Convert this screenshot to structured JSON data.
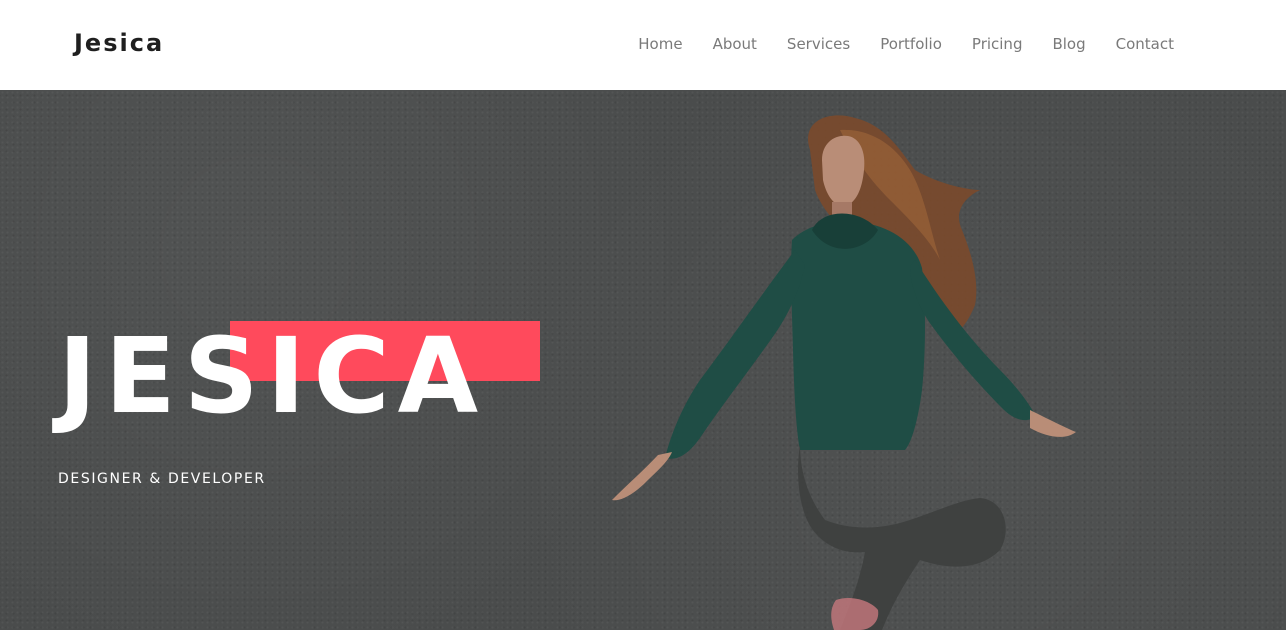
{
  "brand": {
    "logo_text": "Jesica"
  },
  "nav": {
    "items": [
      {
        "label": "Home"
      },
      {
        "label": "About"
      },
      {
        "label": "Services"
      },
      {
        "label": "Portfolio"
      },
      {
        "label": "Pricing"
      },
      {
        "label": "Blog"
      },
      {
        "label": "Contact"
      }
    ]
  },
  "hero": {
    "title": "JESICA",
    "subtitle": "DESIGNER & DEVELOPER",
    "background_photo": "woman-jumping-photo"
  },
  "colors": {
    "accent": "#ff4a5c",
    "header_bg": "#ffffff",
    "logo_text": "#1f1f1f",
    "nav_text": "#7a7a7a",
    "hero_overlay": "#4a4c4c",
    "hero_text": "#ffffff"
  }
}
